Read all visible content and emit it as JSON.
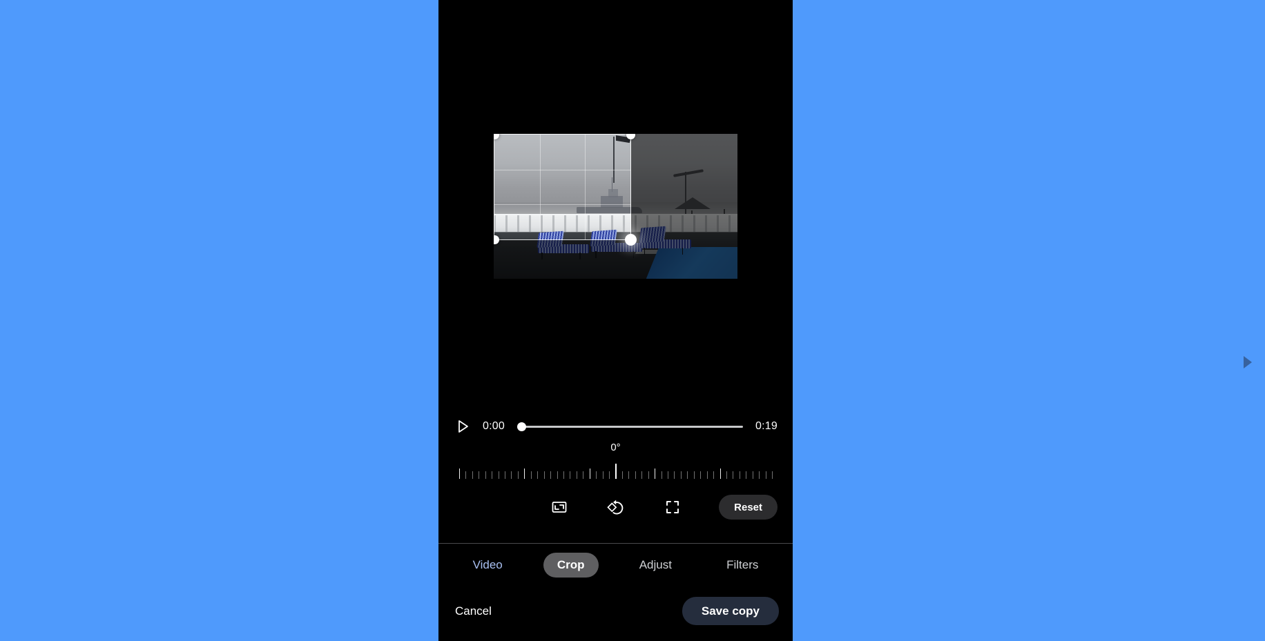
{
  "background": {
    "color": "#4f9afc"
  },
  "app": {
    "window_bg": "#000000"
  },
  "video": {
    "scene_description": "hazy seaside terrace with naval ship on horizon, white balustrade, blue striped sun loungers, swimming pool and thatched umbrella",
    "crop": {
      "handle_names": [
        "top-left",
        "top-right",
        "bottom-left",
        "bottom-right"
      ],
      "grid": "rule-of-thirds"
    }
  },
  "playback": {
    "play_icon": "play-icon",
    "current_time": "0:00",
    "total_time": "0:19",
    "progress_percent": 0
  },
  "rotation": {
    "value_label": "0°",
    "degrees": 0,
    "tick_count": 49,
    "major_every": 10
  },
  "tools": {
    "items": [
      {
        "icon": "aspect-ratio-icon",
        "name": "aspect-ratio-button"
      },
      {
        "icon": "rotate-icon",
        "name": "rotate-button"
      },
      {
        "icon": "expand-icon",
        "name": "expand-button"
      }
    ],
    "reset_label": "Reset"
  },
  "tabs": {
    "items": [
      {
        "label": "Video",
        "selected": false,
        "accent": true
      },
      {
        "label": "Crop",
        "selected": true,
        "accent": false
      },
      {
        "label": "Adjust",
        "selected": false,
        "accent": false
      },
      {
        "label": "Filters",
        "selected": false,
        "accent": false
      }
    ],
    "selected_index": 1
  },
  "actions": {
    "cancel_label": "Cancel",
    "save_label": "Save copy",
    "save_button_color": "#252d3d"
  },
  "colors": {
    "accent_blue": "#a9c0f2",
    "selected_pill": "#5f5f61",
    "reset_pill": "#2c2c2e"
  }
}
